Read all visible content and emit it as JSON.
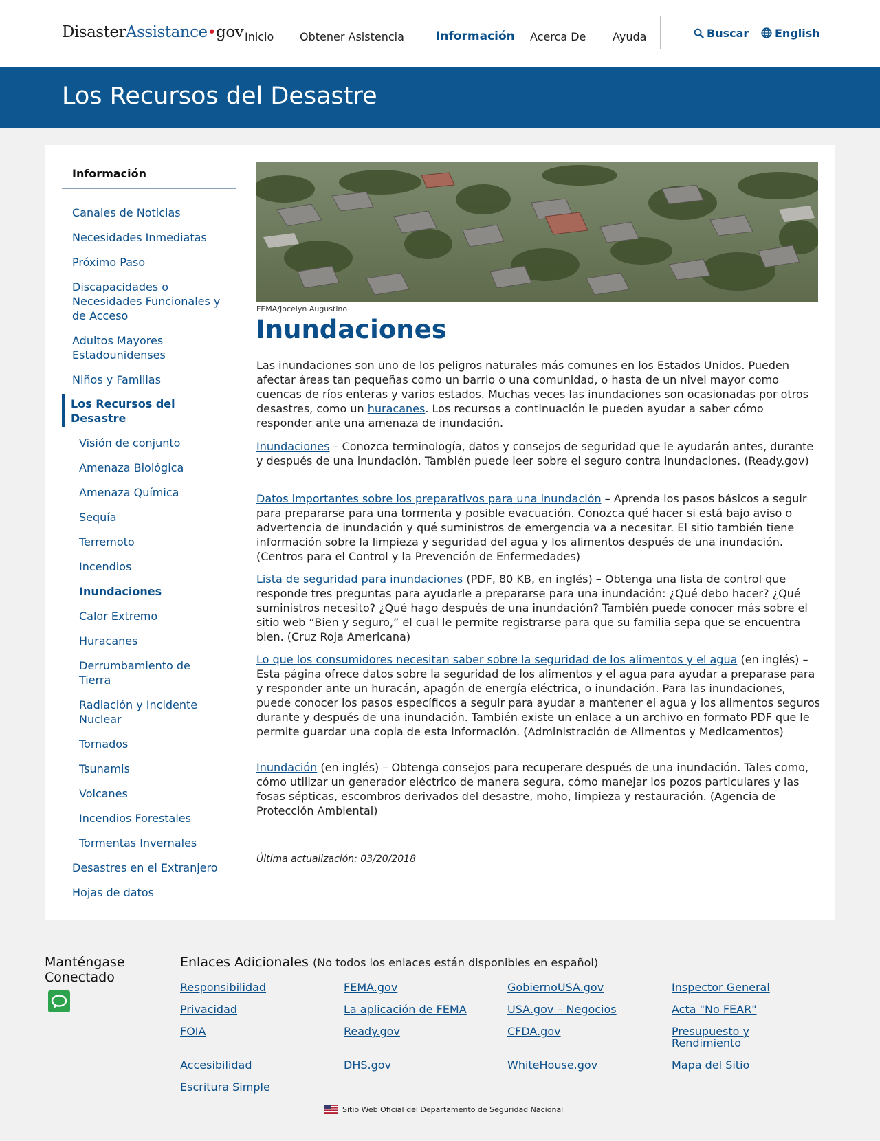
{
  "header": {
    "logo_part1": "Disaster",
    "logo_part2": "Assistance",
    "logo_dot": "•",
    "logo_part3": "gov",
    "nav": [
      "Inicio",
      "Obtener Asistencia",
      "Información",
      "Acerca De",
      "Ayuda"
    ],
    "active_nav": "Información",
    "search_label": "Buscar",
    "language_label": "English"
  },
  "banner": {
    "title": "Los Recursos del Desastre"
  },
  "sidebar": {
    "title": "Información",
    "items": [
      "Canales de Noticias",
      "Necesidades Inmediatas",
      "Próximo Paso",
      "Discapacidades o Necesidades Funcionales y de Acceso",
      "Adultos Mayores Estadounidenses",
      "Niños y Familias",
      "Los Recursos del Desastre",
      "Visión de conjunto",
      "Amenaza Biológica",
      "Amenaza Química",
      "Sequía",
      "Terremoto",
      "Incendios",
      "Inundaciones",
      "Calor Extremo",
      "Huracanes",
      "Derrumbamiento de Tierra",
      "Radiación y Incidente Nuclear",
      "Tornados",
      "Tsunamis",
      "Volcanes",
      "Incendios Forestales",
      "Tormentas Invernales",
      "Desastres en el Extranjero",
      "Hojas de datos"
    ]
  },
  "main": {
    "image_credit": "FEMA/Jocelyn Augustino",
    "title": "Inundaciones",
    "intro_before": "Las inundaciones son uno de los peligros naturales más comunes en los Estados Unidos. Pueden afectar áreas tan pequeñas como un barrio o una comunidad, o hasta de un nivel mayor como cuencas de ríos enteras y varios estados. Muchas veces las inundaciones son ocasionadas por otros desastres, como un ",
    "intro_link": "huracanes",
    "intro_after": ". Los recursos a continuación le pueden ayudar a saber cómo responder ante una amenaza de inundación.",
    "resources": [
      {
        "link": "Inundaciones",
        "text": " – Conozca terminología, datos y consejos de seguridad que le ayudarán antes, durante y después de una inundación. También puede leer sobre el seguro contra inundaciones. (Ready.gov)"
      },
      {
        "link": "Datos importantes sobre los preparativos para una inundación",
        "text": " – Aprenda los pasos básicos a seguir para prepararse para una tormenta y posible evacuación. Conozca qué hacer si está bajo aviso o advertencia de inundación y qué suministros de emergencia va a necesitar. El sitio también tiene información sobre la limpieza y seguridad del agua y los alimentos después de una inundación. (Centros para el Control y la Prevención de Enfermedades)"
      },
      {
        "link": "Lista de seguridad para inundaciones",
        "text": " (PDF, 80 KB, en inglés) – Obtenga una lista de control que responde tres preguntas para ayudarle a prepararse para una inundación: ¿Qué debo hacer? ¿Qué suministros necesito? ¿Qué hago después de una inundación? También puede conocer más sobre el sitio web “Bien y seguro,” el cual le permite registrarse para que su familia sepa que se encuentra bien. (Cruz Roja Americana)"
      },
      {
        "link": "Lo que los consumidores necesitan saber sobre la seguridad de los alimentos y el agua",
        "text": " (en inglés) – Esta página ofrece datos sobre la seguridad de los alimentos y el agua para ayudar a preparase para y responder ante un huracán, apagón de energía eléctrica, o inundación. Para las inundaciones, puede conocer los pasos específicos a seguir para ayudar a mantener el agua y los alimentos seguros durante y después de una inundación. También existe un enlace a un archivo en formato PDF que le permite guardar una copia de esta información. (Administración de Alimentos y Medicamentos)"
      },
      {
        "link": "Inundación",
        "text": " (en inglés) – Obtenga consejos para recuperare después de una inundación. Tales como, cómo utilizar un generador eléctrico de manera segura, cómo manejar los pozos particulares y las fosas sépticas, escombros derivados del desastre, moho, limpieza y restauración. (Agencia de Protección Ambiental)"
      }
    ],
    "last_updated": "Última actualización: 03/20/2018"
  },
  "footer": {
    "connected_title": "Manténgase Conectado",
    "links_title": "Enlaces Adicionales",
    "links_note": "(No todos los enlaces están disponibles en español)",
    "links": [
      "Responsibilidad",
      "FEMA.gov",
      "GobiernoUSA.gov",
      "Inspector General",
      "Privacidad",
      "La aplicación de FEMA",
      "USA.gov – Negocios",
      "Acta \"No FEAR\"",
      "FOIA",
      "Ready.gov",
      "CFDA.gov",
      "Presupuesto y Rendimiento",
      "Accesibilidad",
      "DHS.gov",
      "WhiteHouse.gov",
      "Mapa del Sitio",
      "Escritura Simple"
    ],
    "official_site": "Sitio Web Oficial del Departamento de Seguridad Nacional"
  },
  "colors": {
    "brand_blue": "#0d5690",
    "link_blue": "#0b4f8a",
    "logo_red": "#d21d2b",
    "chat_green": "#2ea34e"
  }
}
